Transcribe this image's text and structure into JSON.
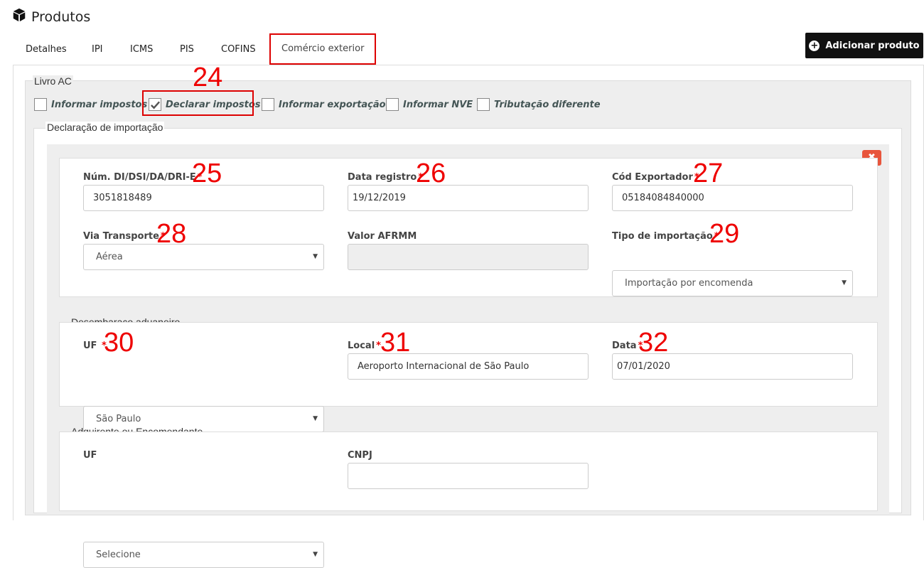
{
  "page": {
    "title": "Produtos",
    "icon": "cube-icon"
  },
  "tabs": [
    {
      "label": "Detalhes"
    },
    {
      "label": "IPI"
    },
    {
      "label": "ICMS"
    },
    {
      "label": "PIS"
    },
    {
      "label": "COFINS"
    },
    {
      "label": "Comércio exterior",
      "active": true
    }
  ],
  "add_button": {
    "label": "Adicionar produto",
    "icon": "plus-circle-icon"
  },
  "livro": {
    "legend": "Livro AC",
    "checkboxes": [
      {
        "label": "Informar impostos",
        "checked": false
      },
      {
        "label": "Declarar impostos",
        "checked": true
      },
      {
        "label": "Informar exportação",
        "checked": false
      },
      {
        "label": "Informar NVE",
        "checked": false
      },
      {
        "label": "Tributação diferente",
        "checked": false
      }
    ]
  },
  "declaracao": {
    "legend": "Declaração de importação",
    "close_icon": "close-icon",
    "fields": {
      "num_di": {
        "label": "Núm. DI/DSI/DA/DRI-E",
        "required": "*",
        "value": "3051818489"
      },
      "data_registro": {
        "label": "Data registro",
        "required": "*",
        "value": "19/12/2019"
      },
      "cod_exportador": {
        "label": "Cód Exportador",
        "required": "*",
        "value": "05184084840000"
      },
      "via_transporte": {
        "label": "Via Transporte",
        "required": "*",
        "value": "Aérea"
      },
      "valor_afrmm": {
        "label": "Valor AFRMM",
        "value": ""
      },
      "tipo_importacao": {
        "label": "Tipo de importação",
        "required": "*",
        "value": "Importação por encomenda"
      }
    }
  },
  "desembaraco": {
    "legend": "Desembaraço aduaneiro",
    "fields": {
      "uf": {
        "label": "UF",
        "required": "*",
        "value": "São Paulo"
      },
      "local": {
        "label": "Local",
        "required": "*",
        "value": "Aeroporto Internacional de São Paulo"
      },
      "data": {
        "label": "Data",
        "required": "*",
        "value": "07/01/2020"
      }
    }
  },
  "adquirente": {
    "legend": "Adquirente ou Encomendante",
    "fields": {
      "uf": {
        "label": "UF",
        "value": "Selecione"
      },
      "cnpj": {
        "label": "CNPJ",
        "value": ""
      }
    }
  },
  "annotations": [
    "24",
    "25",
    "26",
    "27",
    "28",
    "29",
    "30",
    "31",
    "32"
  ],
  "colors": {
    "annotation": "#e00000",
    "button_dark": "#111111",
    "close_button": "#e8553c"
  }
}
